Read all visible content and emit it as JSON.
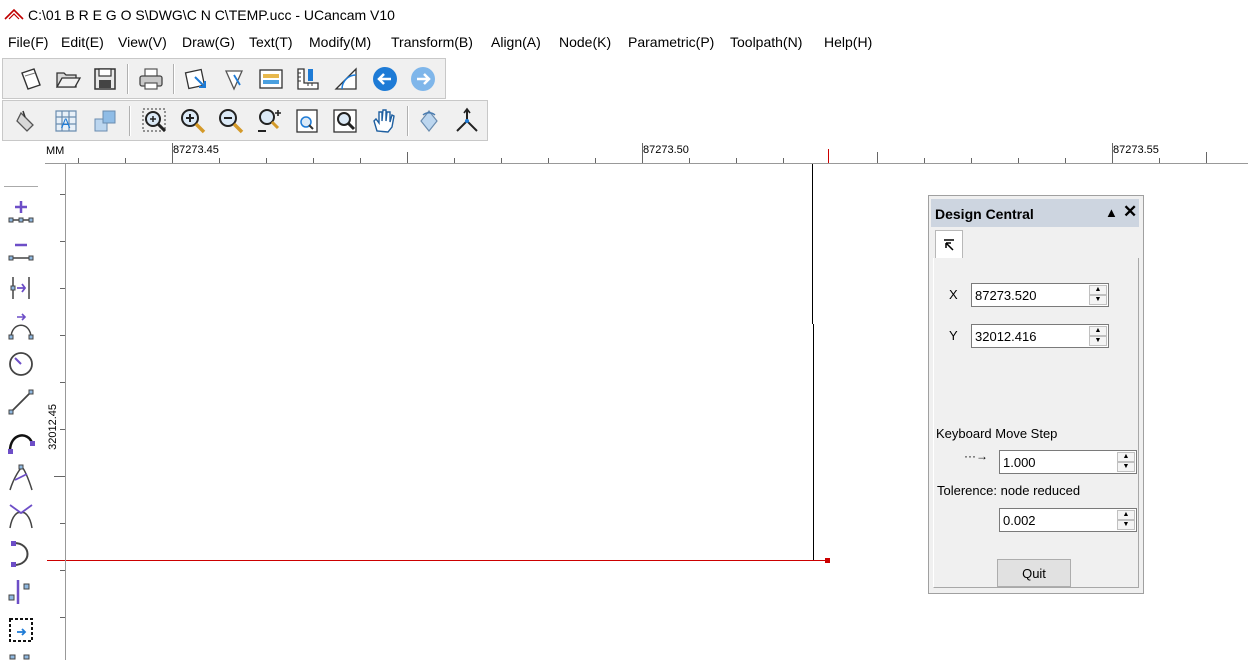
{
  "window": {
    "title": "C:\\01 B R E G O S\\DWG\\C N C\\TEMP.ucc - UCancam V10"
  },
  "menu": [
    "File(F)",
    "Edit(E)",
    "View(V)",
    "Draw(G)",
    "Text(T)",
    "Modify(M)",
    "Transform(B)",
    "Align(A)",
    "Node(K)",
    "Parametric(P)",
    "Toolpath(N)",
    "Help(H)"
  ],
  "ruler": {
    "unit": "MM",
    "top_labels": [
      "87273.45",
      "87273.50",
      "87273.55"
    ],
    "left_label": "32012.45"
  },
  "design_central": {
    "title": "Design Central",
    "x_label": "X",
    "x_value": "87273.520",
    "y_label": "Y",
    "y_value": "32012.416",
    "move_step_label": "Keyboard Move Step",
    "move_step_icon": "···→",
    "move_step_value": "1.000",
    "tolerance_label": "Tolerence: node reduced",
    "tolerance_value": "0.002",
    "quit_label": "Quit"
  },
  "colors": {
    "accent_blue": "#1e7bd6",
    "selection_red": "#cc0000"
  }
}
